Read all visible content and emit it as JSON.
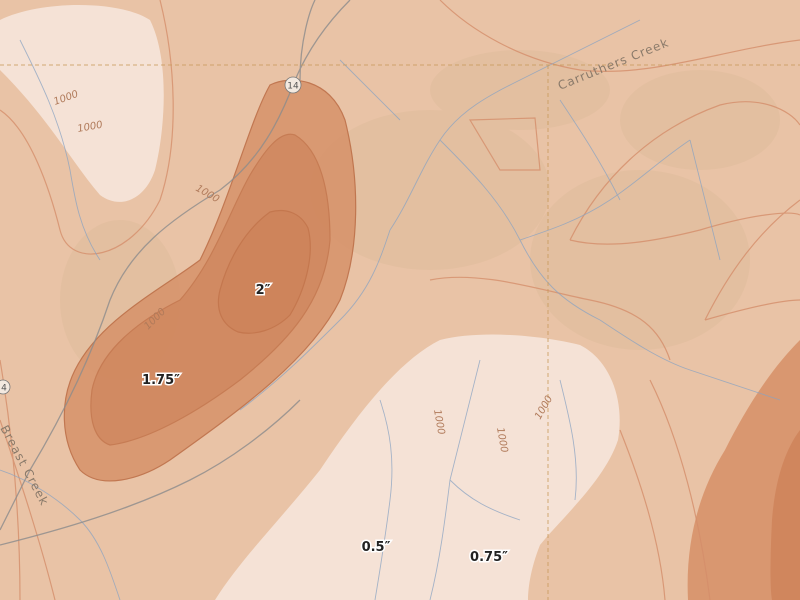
{
  "map": {
    "precipitation_labels": [
      {
        "id": "label-2in",
        "text": "2″"
      },
      {
        "id": "label-175in",
        "text": "1.75″"
      },
      {
        "id": "label-05in",
        "text": "0.5″"
      },
      {
        "id": "label-075in",
        "text": "0.75″"
      }
    ],
    "creeks": {
      "carruthers": "Carruthers Creek",
      "breast": "Breast Creek"
    },
    "highway_shield": "14",
    "edge_route_number": "4",
    "elevation_labels": [
      "1000",
      "1000",
      "1000",
      "1000",
      "1000",
      "1000",
      "1000"
    ],
    "colors": {
      "base": "#e9c3a6",
      "light_band": "#f3dccc",
      "lightest_band": "#f6e6dc",
      "band_1": "#e2ae8a",
      "band_2": "#d68f66",
      "band_3": "#cc7f55",
      "band_outline": "#b8653c",
      "stream": "#8aa3c2",
      "road": "#8c8c8c",
      "boundary": "#c89a5a"
    }
  }
}
